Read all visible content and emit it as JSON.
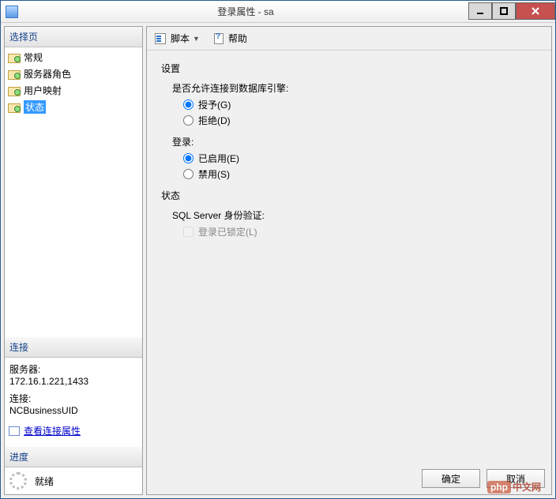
{
  "window": {
    "title": "登录属性 - sa"
  },
  "sidebar": {
    "header": "选择页",
    "items": [
      {
        "label": "常规"
      },
      {
        "label": "服务器角色"
      },
      {
        "label": "用户映射"
      },
      {
        "label": "状态"
      }
    ]
  },
  "connection": {
    "header": "连接",
    "server_label": "服务器:",
    "server_value": "172.16.1.221,1433",
    "conn_label": "连接:",
    "conn_value": "NCBusinessUID",
    "view_link": "查看连接属性"
  },
  "progress": {
    "header": "进度",
    "status": "就绪"
  },
  "toolbar": {
    "script": "脚本",
    "help": "帮助"
  },
  "settings": {
    "title": "设置",
    "perm_label": "是否允许连接到数据库引擎:",
    "perm_grant": "授予(G)",
    "perm_deny": "拒绝(D)",
    "login_label": "登录:",
    "login_enabled": "已启用(E)",
    "login_disabled": "禁用(S)",
    "status_title": "状态",
    "auth_label": "SQL Server 身份验证:",
    "locked_label": "登录已锁定(L)"
  },
  "buttons": {
    "ok": "确定",
    "cancel": "取消"
  },
  "watermark": {
    "php": "php",
    "cn": "中文网"
  }
}
